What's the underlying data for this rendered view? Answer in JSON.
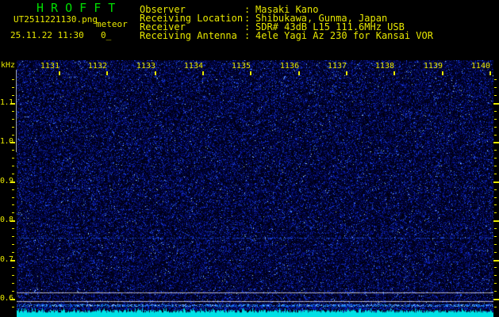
{
  "window": {
    "title": "H R O F F T"
  },
  "file": {
    "name": "UT2511221130.png",
    "tag": "meteor",
    "datetime": "25.11.22 11:30",
    "cursor": "0_"
  },
  "observation": {
    "colon": ":",
    "rows": [
      {
        "label": "Observer",
        "value": "Masaki Kano"
      },
      {
        "label": "Receiving Location",
        "value": "Shibukawa, Gunma, Japan"
      },
      {
        "label": "Receiver",
        "value": "SDR# 43dB L15 111.6MHz USB"
      },
      {
        "label": "Receiving Antenna",
        "value": "4ele Yagi Az 230 for Kansai VOR"
      }
    ]
  },
  "spectrogram": {
    "freq_axis": {
      "unit": "kHz",
      "tick_labels": [
        "1.1",
        "1.0",
        "0.9",
        "0.8",
        "0.7",
        "0.6"
      ]
    },
    "time_axis": {
      "tick_labels": [
        "1131",
        "1132",
        "1133",
        "1134",
        "1135",
        "1136",
        "1137",
        "1138",
        "1139",
        "1140"
      ]
    },
    "band_marker_lines_khz": [
      0.62,
      0.6
    ],
    "colors": {
      "text_yellow": "#e8e800",
      "title_green": "#00dd00",
      "cyan_level_strip": "#00e4e4",
      "marker_gray": "#b4b4b8",
      "noise_base_blue": "#000060"
    }
  }
}
